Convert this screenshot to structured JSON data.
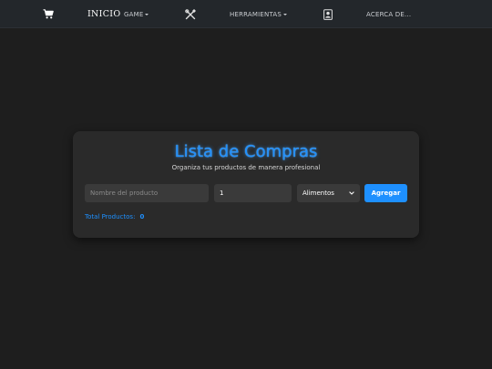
{
  "navbar": {
    "cart_icon": "shopping-cart-icon",
    "home_label": "INICIO",
    "game_label": "GAME",
    "tools_icon": "tools-icon",
    "tools_label": "HERRAMIENTAS",
    "about_icon": "contact-card-icon",
    "about_label": "ACERCA DE..."
  },
  "card": {
    "title": "Lista de Compras",
    "subtitle": "Organiza tus productos de manera profesional",
    "name_placeholder": "Nombre del producto",
    "quantity_value": "1",
    "category_selected": "Alimentos",
    "add_button_label": "Agregar",
    "total_label": "Total Productos:",
    "total_count": "0"
  },
  "colors": {
    "accent": "#1e90ff",
    "background": "#1e1e1e",
    "navbar": "#23272b",
    "card": "#2a2a2a",
    "field": "#3a3a3a"
  }
}
